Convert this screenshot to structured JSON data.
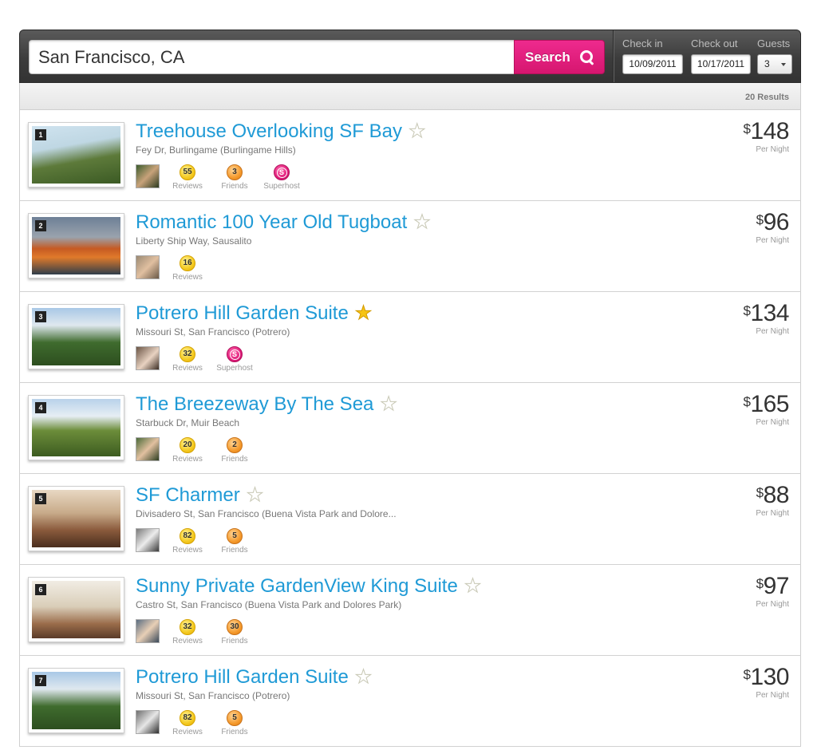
{
  "search": {
    "query": "San Francisco, CA",
    "button_label": "Search",
    "check_in_label": "Check in",
    "check_in_value": "10/09/2011",
    "check_out_label": "Check out",
    "check_out_value": "10/17/2011",
    "guests_label": "Guests",
    "guests_value": "3"
  },
  "results": {
    "count_label": "20 Results"
  },
  "listings": [
    {
      "number": "1",
      "title": "Treehouse Overlooking SF Bay",
      "favorite": false,
      "address": "Fey Dr, Burlingame (Burlingame Hills)",
      "currency": "$",
      "price": "148",
      "period": "Per Night",
      "badges": [
        {
          "type": "reviews",
          "value": "55",
          "label": "Reviews"
        },
        {
          "type": "friends",
          "value": "3",
          "label": "Friends"
        },
        {
          "type": "superhost",
          "value": "S",
          "label": "Superhost"
        }
      ]
    },
    {
      "number": "2",
      "title": "Romantic 100 Year Old Tugboat",
      "favorite": false,
      "address": "Liberty Ship Way, Sausalito",
      "currency": "$",
      "price": "96",
      "period": "Per Night",
      "badges": [
        {
          "type": "reviews",
          "value": "16",
          "label": "Reviews"
        }
      ]
    },
    {
      "number": "3",
      "title": "Potrero Hill Garden Suite",
      "favorite": true,
      "address": "Missouri St, San Francisco (Potrero)",
      "currency": "$",
      "price": "134",
      "period": "Per Night",
      "badges": [
        {
          "type": "reviews",
          "value": "32",
          "label": "Reviews"
        },
        {
          "type": "superhost",
          "value": "S",
          "label": "Superhost"
        }
      ]
    },
    {
      "number": "4",
      "title": "The Breezeway By The Sea",
      "favorite": false,
      "address": "Starbuck Dr, Muir Beach",
      "currency": "$",
      "price": "165",
      "period": "Per Night",
      "badges": [
        {
          "type": "reviews",
          "value": "20",
          "label": "Reviews"
        },
        {
          "type": "friends",
          "value": "2",
          "label": "Friends"
        }
      ]
    },
    {
      "number": "5",
      "title": "SF Charmer",
      "favorite": false,
      "address": "Divisadero St, San Francisco (Buena Vista Park and Dolore...",
      "currency": "$",
      "price": "88",
      "period": "Per Night",
      "badges": [
        {
          "type": "reviews",
          "value": "82",
          "label": "Reviews"
        },
        {
          "type": "friends",
          "value": "5",
          "label": "Friends"
        }
      ]
    },
    {
      "number": "6",
      "title": "Sunny Private GardenView King Suite",
      "favorite": false,
      "address": "Castro St, San Francisco (Buena Vista Park and Dolores Park)",
      "currency": "$",
      "price": "97",
      "period": "Per Night",
      "badges": [
        {
          "type": "reviews",
          "value": "32",
          "label": "Reviews"
        },
        {
          "type": "friends",
          "value": "30",
          "label": "Friends"
        }
      ]
    },
    {
      "number": "7",
      "title": "Potrero Hill Garden Suite",
      "favorite": false,
      "address": "Missouri St, San Francisco (Potrero)",
      "currency": "$",
      "price": "130",
      "period": "Per Night",
      "badges": [
        {
          "type": "reviews",
          "value": "82",
          "label": "Reviews"
        },
        {
          "type": "friends",
          "value": "5",
          "label": "Friends"
        }
      ]
    }
  ]
}
